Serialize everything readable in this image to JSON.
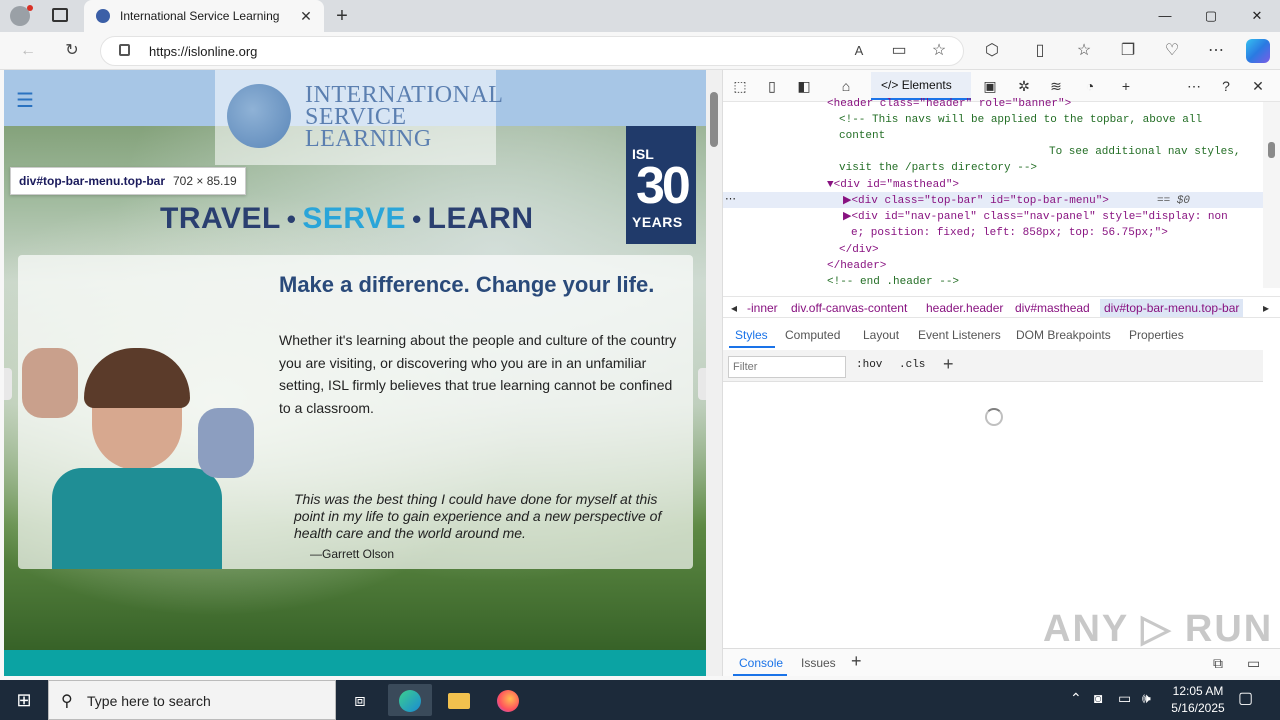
{
  "browser": {
    "tab_title": "International Service Learning",
    "url": "https://islonline.org",
    "tab_close": "✕",
    "new_tab": "+",
    "window_minimize": "—",
    "window_maximize": "▢",
    "window_close": "✕"
  },
  "page": {
    "logo_line1": "INTERNATIONAL",
    "logo_line2": "SERVICE",
    "logo_line3": "LEARNING",
    "badge_isl": "ISL",
    "badge_number": "30",
    "badge_years": "YEARS",
    "tagline_travel": "TRAVEL",
    "tagline_serve": "SERVE",
    "tagline_learn": "LEARN",
    "tagline_sep": "•",
    "headline": "Make a difference. Change your life.",
    "body": "Whether it's learning about the people and culture of the country you are visiting, or discovering who you are in an unfamiliar setting, ISL firmly believes that true learning cannot be confined to a classroom.",
    "quote": "This was the best thing I could have done for myself at this point in my life to gain experience and a new perspective of health care and the world around me.",
    "quote_author": "—Garrett Olson",
    "tooltip_selector": "div#top-bar-menu.top-bar",
    "tooltip_size": "702 × 85.19"
  },
  "devtools": {
    "elements_tab": "Elements",
    "dom_lines": [
      "<header class=\"header\" role=\"banner\">",
      "<!-- This navs will be applied to the topbar, above all",
      "content",
      "To see additional nav styles,",
      "visit the /parts directory -->",
      "▼<div id=\"masthead\">",
      "▶<div class=\"top-bar\" id=\"top-bar-menu\">",
      "▶<div id=\"nav-panel\" class=\"nav-panel\" style=\"display: non",
      "e; position: fixed; left: 858px; top: 56.75px;\">",
      "</div>",
      "</header>",
      "<!-- end .header -->"
    ],
    "selected_suffix": "== $0",
    "ellipsis": "⋯",
    "breadcrumbs": [
      "-inner",
      "div.off-canvas-content",
      "header.header",
      "div#masthead",
      "div#top-bar-menu.top-bar"
    ],
    "subtabs": [
      "Styles",
      "Computed",
      "Layout",
      "Event Listeners",
      "DOM Breakpoints",
      "Properties"
    ],
    "filter_placeholder": "Filter",
    "hov": ":hov",
    ".cls": ".cls",
    "plus": "+",
    "drawer_console": "Console",
    "drawer_issues": "Issues",
    "watermark": "ANY ▷ RUN"
  },
  "taskbar": {
    "search_placeholder": "Type here to search",
    "time": "12:05 AM",
    "date": "5/16/2025"
  }
}
